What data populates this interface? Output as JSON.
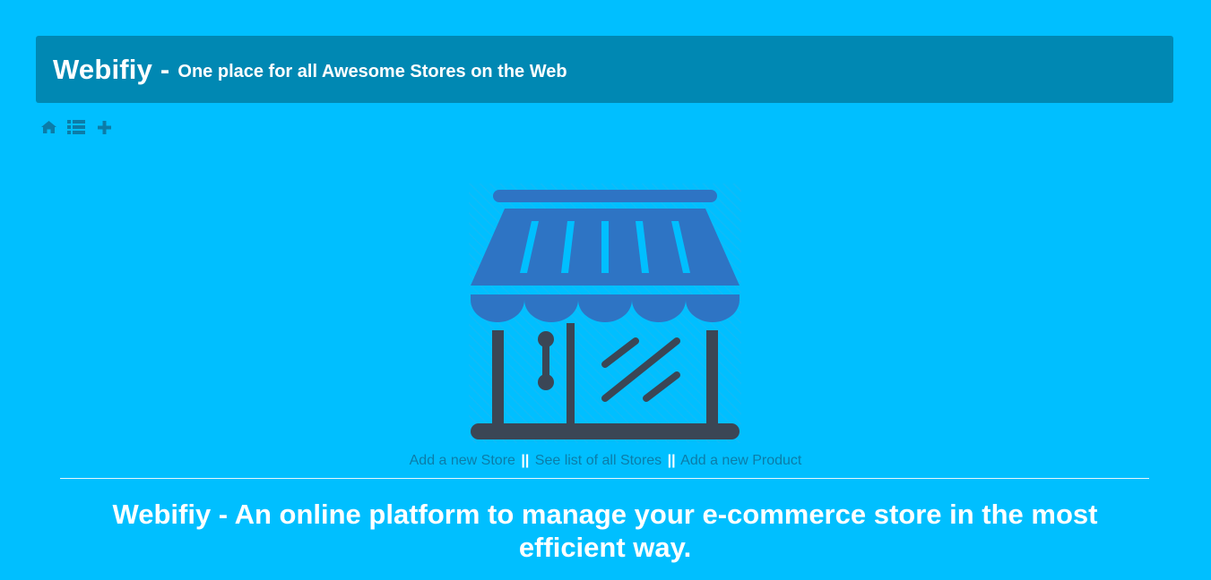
{
  "header": {
    "brand": "Webifiy -",
    "tagline": "One place for all Awesome Stores on the Web"
  },
  "toolbar": {
    "icons": [
      "home-icon",
      "list-icon",
      "plus-icon"
    ],
    "icon_color": "#0c7ca8"
  },
  "hero": {
    "illustration": "storefront-icon",
    "links": {
      "add_store": "Add a new Store",
      "separator": "||",
      "see_stores": "See list of all Stores",
      "add_product": "Add a new Product"
    }
  },
  "headline": "Webifiy - An online platform to manage your e-commerce store in the most efficient way.",
  "colors": {
    "background": "#00bfff",
    "header_bg": "#0088b3",
    "awning": "#2e74c4",
    "frame": "#3b4655",
    "link": "#0c7ca8",
    "text": "#ffffff"
  }
}
